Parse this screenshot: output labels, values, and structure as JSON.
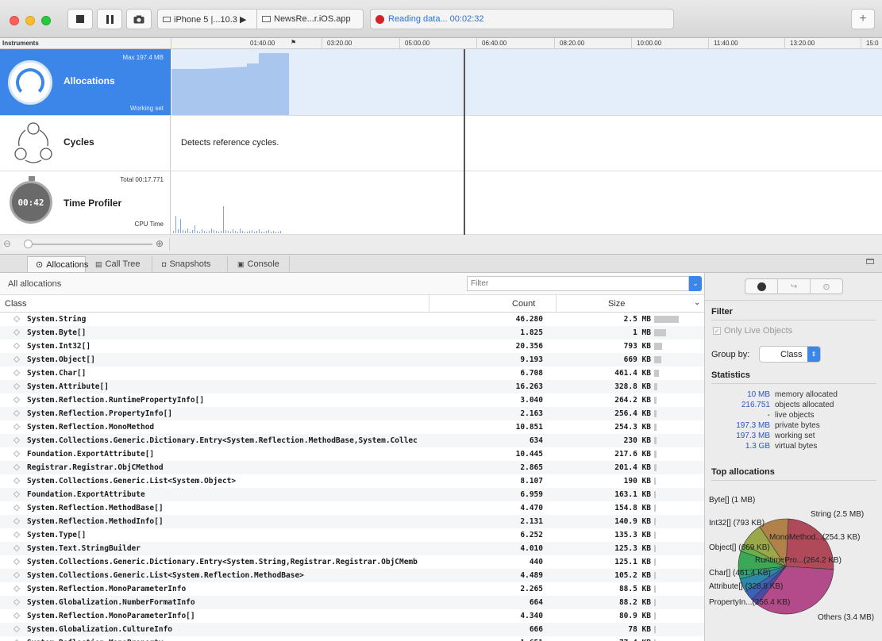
{
  "toolbar": {
    "device": "iPhone 5 |...10.3 ▶",
    "app": "NewsRe...r.iOS.app",
    "status": "Reading data... 00:02:32",
    "add_label": "+"
  },
  "ruler": {
    "header": "Instruments",
    "ticks": [
      "01:40.00",
      "03:20.00",
      "05:00.00",
      "06:40.00",
      "08:20.00",
      "10:00.00",
      "11:40.00",
      "13:20.00",
      "15:0"
    ]
  },
  "instruments": {
    "allocations": {
      "name": "Allocations",
      "max": "Max 197.4 MB",
      "sub": "Working set"
    },
    "cycles": {
      "name": "Cycles",
      "detail": "Detects reference cycles."
    },
    "profiler": {
      "name": "Time Profiler",
      "total": "Total 00:17.771",
      "sub": "CPU Time",
      "clock": "00:42"
    }
  },
  "tabs": [
    "Allocations",
    "Call Tree",
    "Snapshots",
    "Console"
  ],
  "subbar": {
    "title": "All allocations",
    "filter_placeholder": "Filter"
  },
  "columns": {
    "class": "Class",
    "count": "Count",
    "size": "Size"
  },
  "rows": [
    {
      "cls": "System.String",
      "count": "46.280",
      "size": "2.5 MB",
      "bar": 0.62
    },
    {
      "cls": "System.Byte[]",
      "count": "1.825",
      "size": "1 MB",
      "bar": 0.3
    },
    {
      "cls": "System.Int32[]",
      "count": "20.356",
      "size": "793 KB",
      "bar": 0.2
    },
    {
      "cls": "System.Object[]",
      "count": "9.193",
      "size": "669 KB",
      "bar": 0.17
    },
    {
      "cls": "System.Char[]",
      "count": "6.708",
      "size": "461.4 KB",
      "bar": 0.12
    },
    {
      "cls": "System.Attribute[]",
      "count": "16.263",
      "size": "328.8 KB",
      "bar": 0.08
    },
    {
      "cls": "System.Reflection.RuntimePropertyInfo[]",
      "count": "3.040",
      "size": "264.2 KB",
      "bar": 0.06
    },
    {
      "cls": "System.Reflection.PropertyInfo[]",
      "count": "2.163",
      "size": "256.4 KB",
      "bar": 0.06
    },
    {
      "cls": "System.Reflection.MonoMethod",
      "count": "10.851",
      "size": "254.3 KB",
      "bar": 0.06
    },
    {
      "cls": "System.Collections.Generic.Dictionary.Entry<System.Reflection.MethodBase,System.Collec",
      "count": "634",
      "size": "230 KB",
      "bar": 0.05
    },
    {
      "cls": "Foundation.ExportAttribute[]",
      "count": "10.445",
      "size": "217.6 KB",
      "bar": 0.05
    },
    {
      "cls": "Registrar.Registrar.ObjCMethod",
      "count": "2.865",
      "size": "201.4 KB",
      "bar": 0.05
    },
    {
      "cls": "System.Collections.Generic.List<System.Object>",
      "count": "8.107",
      "size": "190 KB",
      "bar": 0.04
    },
    {
      "cls": "Foundation.ExportAttribute",
      "count": "6.959",
      "size": "163.1 KB",
      "bar": 0.04
    },
    {
      "cls": "System.Reflection.MethodBase[]",
      "count": "4.470",
      "size": "154.8 KB",
      "bar": 0.04
    },
    {
      "cls": "System.Reflection.MethodInfo[]",
      "count": "2.131",
      "size": "140.9 KB",
      "bar": 0.03
    },
    {
      "cls": "System.Type[]",
      "count": "6.252",
      "size": "135.3 KB",
      "bar": 0.03
    },
    {
      "cls": "System.Text.StringBuilder",
      "count": "4.010",
      "size": "125.3 KB",
      "bar": 0.03
    },
    {
      "cls": "System.Collections.Generic.Dictionary.Entry<System.String,Registrar.Registrar.ObjCMemb",
      "count": "440",
      "size": "125.1 KB",
      "bar": 0.03
    },
    {
      "cls": "System.Collections.Generic.List<System.Reflection.MethodBase>",
      "count": "4.489",
      "size": "105.2 KB",
      "bar": 0.03
    },
    {
      "cls": "System.Reflection.MonoParameterInfo",
      "count": "2.265",
      "size": "88.5 KB",
      "bar": 0.02
    },
    {
      "cls": "System.Globalization.NumberFormatInfo",
      "count": "664",
      "size": "88.2 KB",
      "bar": 0.02
    },
    {
      "cls": "System.Reflection.MonoParameterInfo[]",
      "count": "4.340",
      "size": "80.9 KB",
      "bar": 0.02
    },
    {
      "cls": "System.Globalization.CultureInfo",
      "count": "666",
      "size": "78 KB",
      "bar": 0.02
    },
    {
      "cls": "System.Reflection.MonoProperty",
      "count": "1.651",
      "size": "77.4 KB",
      "bar": 0.02
    }
  ],
  "side": {
    "filter_title": "Filter",
    "only_live": "Only Live Objects",
    "group_by_label": "Group by:",
    "group_by_value": "Class",
    "stats_title": "Statistics",
    "stats": [
      {
        "v": "10 MB",
        "l": "memory allocated"
      },
      {
        "v": "216.751",
        "l": "objects allocated"
      },
      {
        "v": "-",
        "l": "live objects"
      },
      {
        "v": "197.3 MB",
        "l": "private bytes"
      },
      {
        "v": "197.3 MB",
        "l": "working set"
      },
      {
        "v": "1.3 GB",
        "l": "virtual bytes"
      }
    ],
    "top_title": "Top allocations",
    "pie_labels": {
      "byte": "Byte[] (1 MB)",
      "string": "String (2.5 MB)",
      "int32": "Int32[] (793 KB)",
      "mono": "MonoMethod...(254.3 KB)",
      "object": "Object[] (669 KB)",
      "runtime": "RuntimePro...(264.2 KB)",
      "char": "Char[] (461.4 KB)",
      "attribute": "Attribute[] (328.8 KB)",
      "property": "PropertyIn...(256.4 KB)",
      "others": "Others (3.4 MB)"
    }
  },
  "pie": {
    "slices": [
      {
        "name": "String",
        "value": 2.5,
        "color": "#b04a5a"
      },
      {
        "name": "Others",
        "value": 3.4,
        "color": "#b34a8a"
      },
      {
        "name": "PropertyInfo[]",
        "value": 0.256,
        "color": "#4a4aa8"
      },
      {
        "name": "Attribute[]",
        "value": 0.329,
        "color": "#3a62b8"
      },
      {
        "name": "Char[]",
        "value": 0.461,
        "color": "#2e86a8"
      },
      {
        "name": "RuntimePropertyInfo[]",
        "value": 0.264,
        "color": "#2ea07a"
      },
      {
        "name": "Object[]",
        "value": 0.669,
        "color": "#3aa856"
      },
      {
        "name": "MonoMethod",
        "value": 0.254,
        "color": "#6ab04a"
      },
      {
        "name": "Int32[]",
        "value": 0.793,
        "color": "#9aa84a"
      },
      {
        "name": "Byte[]",
        "value": 1.0,
        "color": "#b0824a"
      }
    ]
  }
}
